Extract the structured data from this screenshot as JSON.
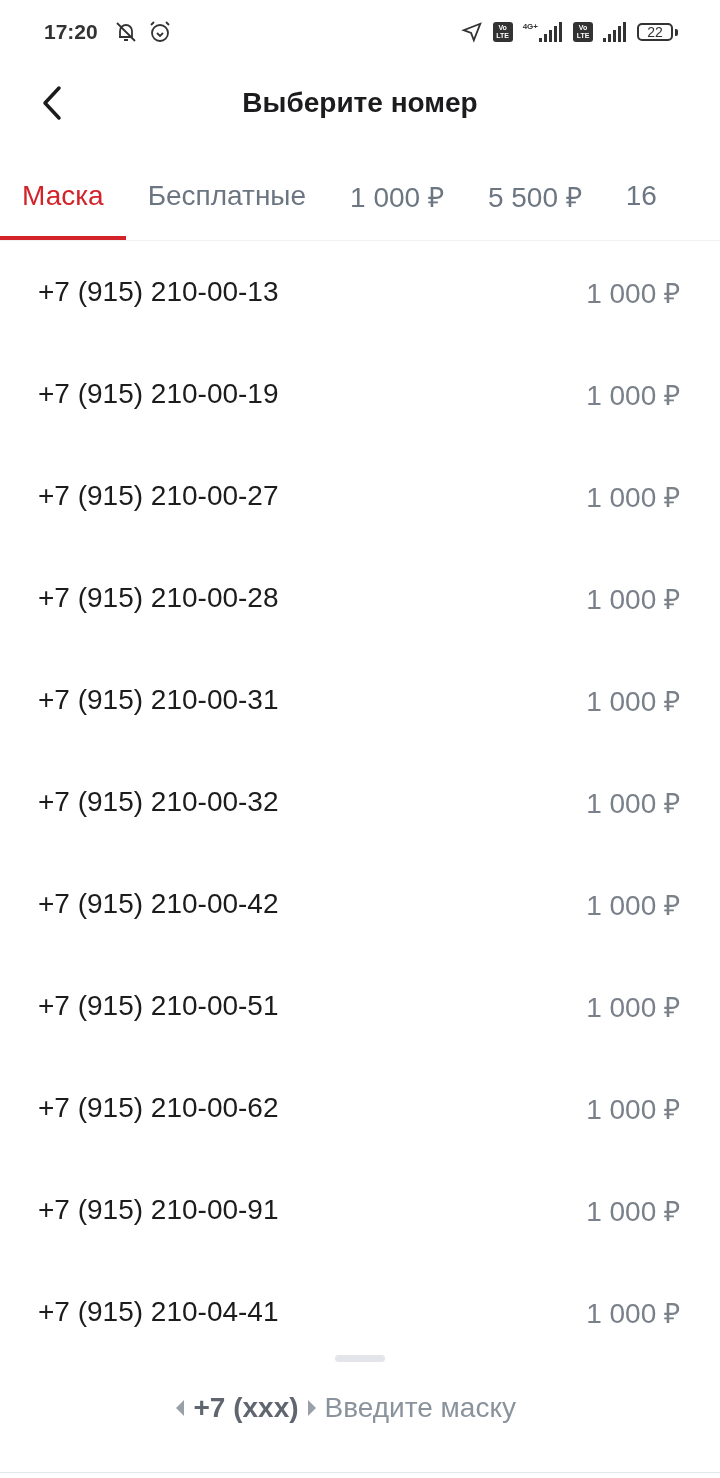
{
  "status_bar": {
    "time": "17:20",
    "volte": [
      [
        "Vo",
        "LTE"
      ],
      [
        "Vo",
        "LTE"
      ]
    ],
    "network": "4G+",
    "battery": "22"
  },
  "header": {
    "title": "Выберите номер"
  },
  "tabs": [
    {
      "label": "Маска",
      "selected": true
    },
    {
      "label": "Бесплатные",
      "selected": false
    },
    {
      "label": "1 000 ₽",
      "selected": false
    },
    {
      "label": "5 500 ₽",
      "selected": false
    },
    {
      "label": "16",
      "selected": false
    }
  ],
  "numbers": [
    {
      "number": "+7 (915) 210-00-13",
      "price": "1 000 ₽"
    },
    {
      "number": "+7 (915) 210-00-19",
      "price": "1 000 ₽"
    },
    {
      "number": "+7 (915) 210-00-27",
      "price": "1 000 ₽"
    },
    {
      "number": "+7 (915) 210-00-28",
      "price": "1 000 ₽"
    },
    {
      "number": "+7 (915) 210-00-31",
      "price": "1 000 ₽"
    },
    {
      "number": "+7 (915) 210-00-32",
      "price": "1 000 ₽"
    },
    {
      "number": "+7 (915) 210-00-42",
      "price": "1 000 ₽"
    },
    {
      "number": "+7 (915) 210-00-51",
      "price": "1 000 ₽"
    },
    {
      "number": "+7 (915) 210-00-62",
      "price": "1 000 ₽"
    },
    {
      "number": "+7 (915) 210-00-91",
      "price": "1 000 ₽"
    },
    {
      "number": "+7 (915) 210-04-41",
      "price": "1 000 ₽"
    }
  ],
  "mask": {
    "prefix": "+7 (xxx)",
    "placeholder": "Введите маску"
  }
}
